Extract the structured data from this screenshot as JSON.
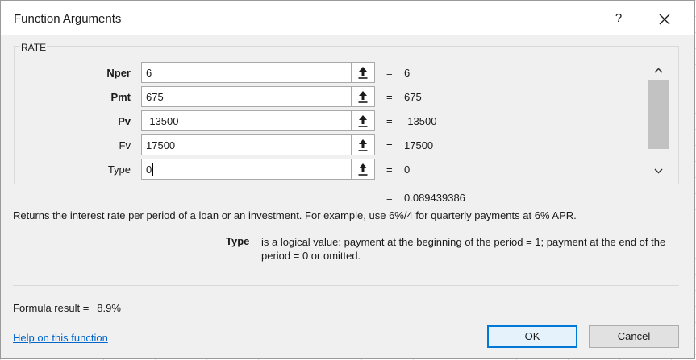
{
  "window": {
    "title": "Function Arguments",
    "help_symbol": "?",
    "close_icon": "close-icon"
  },
  "function_name": "RATE",
  "arguments": [
    {
      "label": "Nper",
      "bold": true,
      "value": "6",
      "result": "6"
    },
    {
      "label": "Pmt",
      "bold": true,
      "value": "675",
      "result": "675"
    },
    {
      "label": "Pv",
      "bold": true,
      "value": "-13500",
      "result": "-13500"
    },
    {
      "label": "Fv",
      "bold": false,
      "value": "17500",
      "result": "17500"
    },
    {
      "label": "Type",
      "bold": false,
      "value": "0",
      "result": "0"
    }
  ],
  "equals_sign": "=",
  "function_result": "0.089439386",
  "description": "Returns the interest rate per period of a loan or an investment. For example, use 6%/4 for quarterly payments at 6% APR.",
  "argument_help": {
    "name": "Type",
    "text": "is a logical value: payment at the beginning of the period = 1; payment at the end of the period = 0 or omitted."
  },
  "formula_result": {
    "label": "Formula result =",
    "value": "8.9%"
  },
  "help_link": "Help on this function",
  "buttons": {
    "ok": "OK",
    "cancel": "Cancel"
  }
}
